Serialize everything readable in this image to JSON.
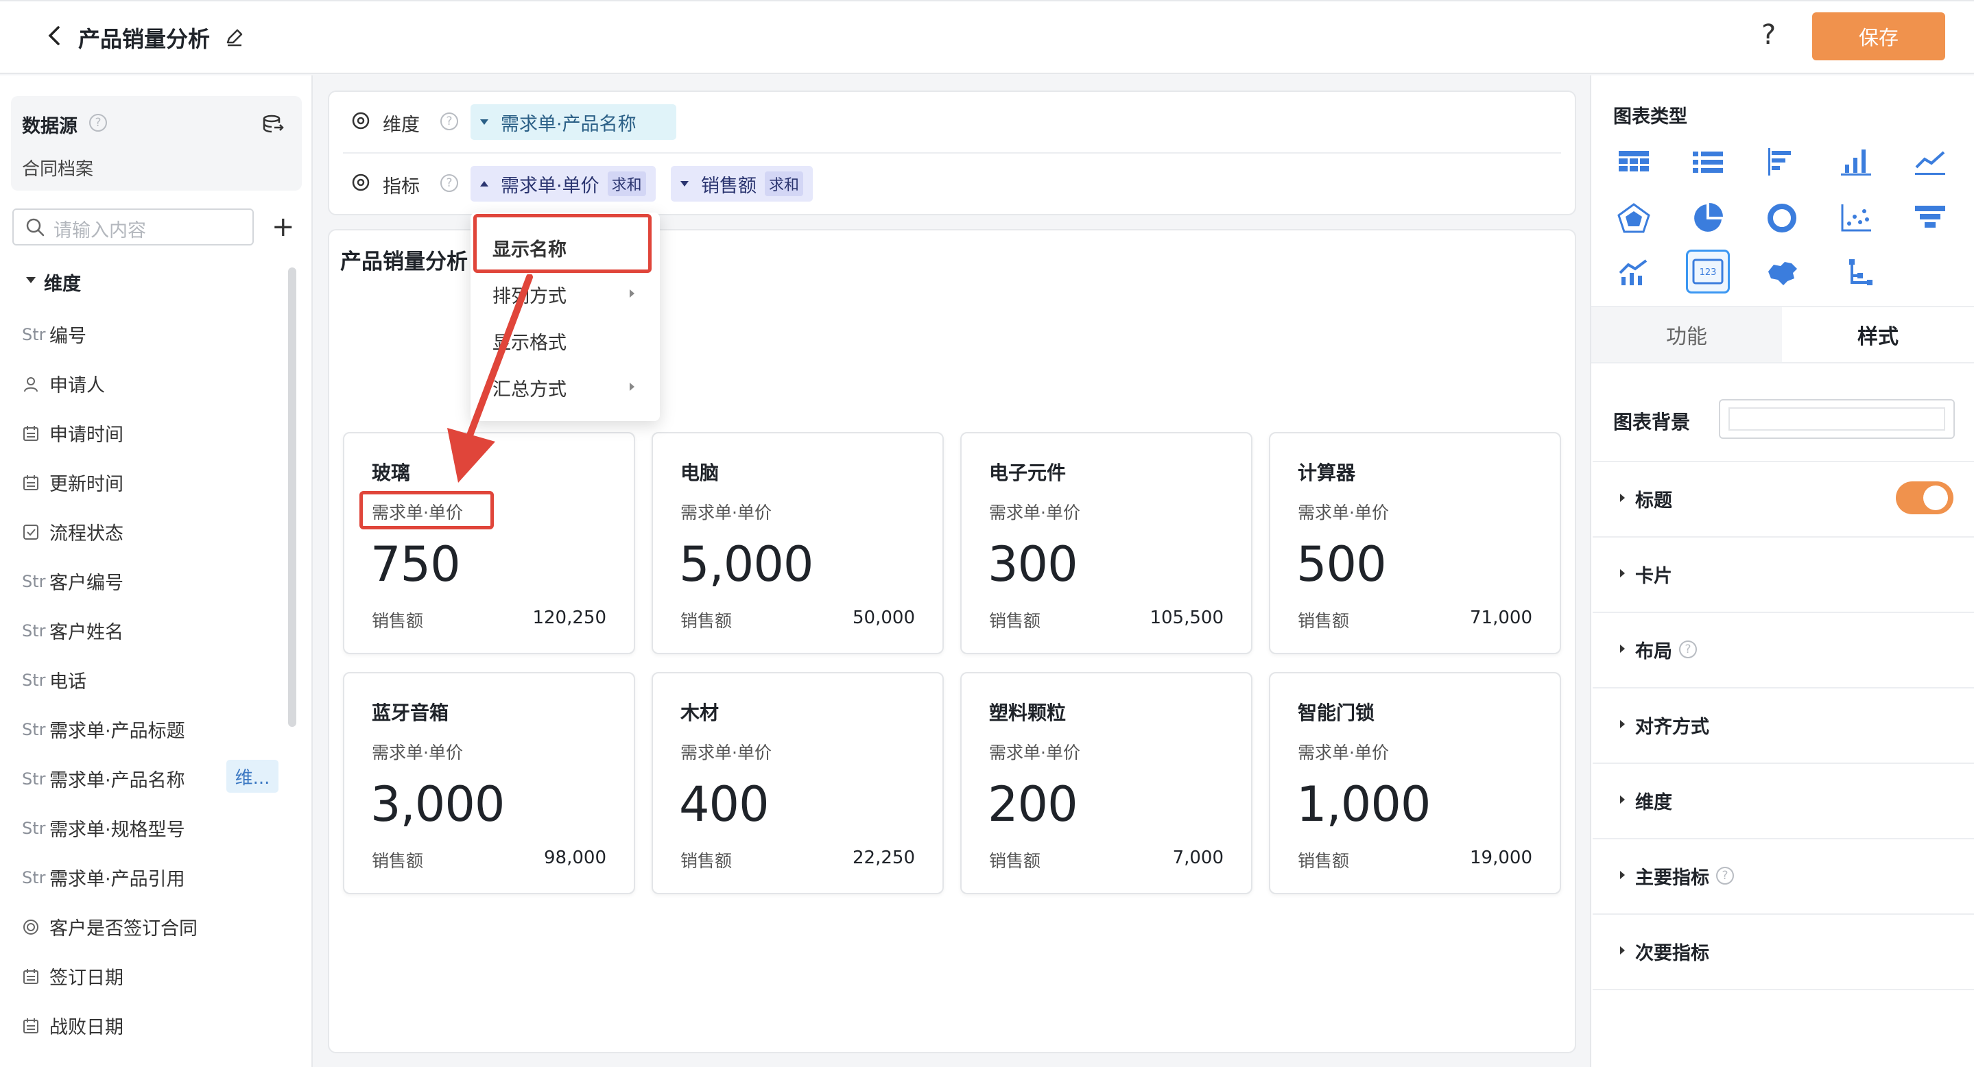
{
  "header": {
    "title": "产品销量分析",
    "help": "?",
    "save_label": "保存"
  },
  "left": {
    "datasource_title": "数据源",
    "datasource_help": "?",
    "datasource_name": "合同档案",
    "search_placeholder": "请输入内容",
    "add": "+",
    "dimension_header": "维度",
    "fields": [
      {
        "type": "Str",
        "label": "编号"
      },
      {
        "type": "user",
        "label": "申请人"
      },
      {
        "type": "date",
        "label": "申请时间"
      },
      {
        "type": "date",
        "label": "更新时间"
      },
      {
        "type": "check",
        "label": "流程状态"
      },
      {
        "type": "Str",
        "label": "客户编号"
      },
      {
        "type": "Str",
        "label": "客户姓名"
      },
      {
        "type": "Str",
        "label": "电话"
      },
      {
        "type": "Str",
        "label": "需求单·产品标题"
      },
      {
        "type": "Str",
        "label": "需求单·产品名称"
      },
      {
        "type": "Str",
        "label": "需求单·规格型号"
      },
      {
        "type": "Str",
        "label": "需求单·产品引用"
      },
      {
        "type": "radio",
        "label": "客户是否签订合同"
      },
      {
        "type": "date",
        "label": "签订日期"
      },
      {
        "type": "date",
        "label": "战败日期"
      }
    ],
    "dimension_tag": "维..."
  },
  "config": {
    "dimension_label": "维度",
    "measure_label": "指标",
    "help": "?",
    "dimension_pill": "需求单·产品名称",
    "measure_pill_1": "需求单·单价",
    "measure_pill_1_agg": "求和",
    "measure_pill_2": "销售额",
    "measure_pill_2_agg": "求和"
  },
  "menu": {
    "items": [
      "显示名称",
      "排列方式",
      "显示格式",
      "汇总方式"
    ]
  },
  "chart": {
    "title": "产品销量分析",
    "cards": [
      {
        "name": "玻璃",
        "label": "需求单·单价",
        "value": "750",
        "sub_label": "销售额",
        "sub_value": "120,250"
      },
      {
        "name": "电脑",
        "label": "需求单·单价",
        "value": "5,000",
        "sub_label": "销售额",
        "sub_value": "50,000"
      },
      {
        "name": "电子元件",
        "label": "需求单·单价",
        "value": "300",
        "sub_label": "销售额",
        "sub_value": "105,500"
      },
      {
        "name": "计算器",
        "label": "需求单·单价",
        "value": "500",
        "sub_label": "销售额",
        "sub_value": "71,000"
      },
      {
        "name": "蓝牙音箱",
        "label": "需求单·单价",
        "value": "3,000",
        "sub_label": "销售额",
        "sub_value": "98,000"
      },
      {
        "name": "木材",
        "label": "需求单·单价",
        "value": "400",
        "sub_label": "销售额",
        "sub_value": "22,250"
      },
      {
        "name": "塑料颗粒",
        "label": "需求单·单价",
        "value": "200",
        "sub_label": "销售额",
        "sub_value": "7,000"
      },
      {
        "name": "智能门锁",
        "label": "需求单·单价",
        "value": "1,000",
        "sub_label": "销售额",
        "sub_value": "19,000"
      }
    ]
  },
  "right": {
    "chart_type_title": "图表类型",
    "chart_types": [
      "table-icon",
      "list-icon",
      "bar-horizontal-icon",
      "bar-vertical-icon",
      "line-icon",
      "radar-icon",
      "pie-icon",
      "donut-icon",
      "scatter-icon",
      "funnel-icon",
      "combo-icon",
      "indicator-card-icon",
      "map-icon",
      "tree-icon"
    ],
    "selected_chart_type": "indicator-card-icon",
    "indicator_glyph": "123",
    "tab_function": "功能",
    "tab_style": "样式",
    "background_label": "图表背景",
    "sections": [
      "标题",
      "卡片",
      "布局",
      "对齐方式",
      "维度",
      "主要指标",
      "次要指标"
    ],
    "section_help": "?",
    "title_toggle_on": true
  },
  "colors": {
    "accent": "#f0924d",
    "highlight": "#e0453a",
    "selected": "#3b97f2"
  }
}
